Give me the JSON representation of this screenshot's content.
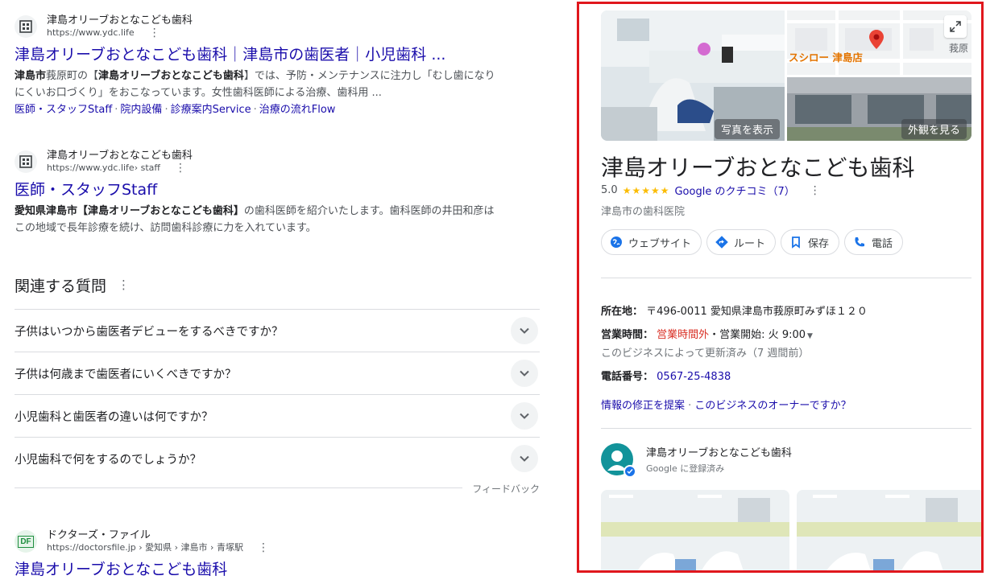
{
  "results": [
    {
      "site_name": "津島オリーブおとなこども歯科",
      "url": "https://www.ydc.life",
      "title": "津島オリーブおとなこども歯科｜津島市の歯医者｜小児歯科 ...",
      "snippet_b1": "津島市",
      "snippet_t1": "莪原町の【",
      "snippet_b2": "津島オリーブおとなこども歯科",
      "snippet_t2": "】では、予防・メンテナンスに注力し「むし歯になりにくいお口づくり」をおこなっています。女性歯科医師による治療、歯科用 ...",
      "sitelinks": [
        "医師・スタッフStaff",
        "院内設備",
        "診療案内Service",
        "治療の流れFlow"
      ]
    },
    {
      "site_name": "津島オリーブおとなこども歯科",
      "url": "https://www.ydc.life",
      "url_path": " › staff",
      "title": "医師・スタッフStaff",
      "snippet_b1": "愛知県津島市【津島オリーブおとなこども歯科】",
      "snippet_t1": "の歯科医師を紹介いたします。歯科医師の井田和彦はこの地域で長年診療を続け、訪問歯科診療に力を入れています。"
    },
    {
      "site_name": "ドクターズ・ファイル",
      "url": "https://doctorsfile.jp › 愛知県 › 津島市 › 青塚駅",
      "favicon_text": "DF",
      "title": "津島オリーブおとなこども歯科"
    }
  ],
  "paa": {
    "heading": "関連する質問",
    "questions": [
      "子供はいつから歯医者デビューをするべきですか？",
      "子供は何歳まで歯医者にいくべきですか？",
      "小児歯科と歯医者の違いは何ですか？",
      "小児歯科で何をするのでしょうか？"
    ],
    "feedback": "フィードバック"
  },
  "kp": {
    "photo_btn": "写真を表示",
    "street_btn": "外観を見る",
    "map_label": "スシロー 津島店",
    "map_label2": "莪原",
    "title": "津島オリーブおとなこども歯科",
    "rating": "5.0",
    "stars": "★★★★★",
    "review_link": "Google のクチコミ（7）",
    "category": "津島市の歯科医院",
    "actions": [
      "ウェブサイト",
      "ルート",
      "保存",
      "電話"
    ],
    "address_label": "所在地：",
    "address": "〒496-0011 愛知県津島市莪原町みずほ１２０",
    "hours_label": "営業時間：",
    "hours_closed": "営業時間外",
    "hours_open": "・営業開始: 火 9:00",
    "hours_note": "このビジネスによって更新済み（7 週間前）",
    "phone_label": "電話番号：",
    "phone": "0567-25-4838",
    "edit_link": "情報の修正を提案",
    "owner_link": "このビジネスのオーナーですか？",
    "owner_name": "津島オリーブおとなこども歯科",
    "owner_sub": "Google に登録済み"
  },
  "colors": {
    "link": "#1a0dab",
    "highlight_border": "#e0171d",
    "closed": "#d93025",
    "star": "#fbbc04"
  }
}
